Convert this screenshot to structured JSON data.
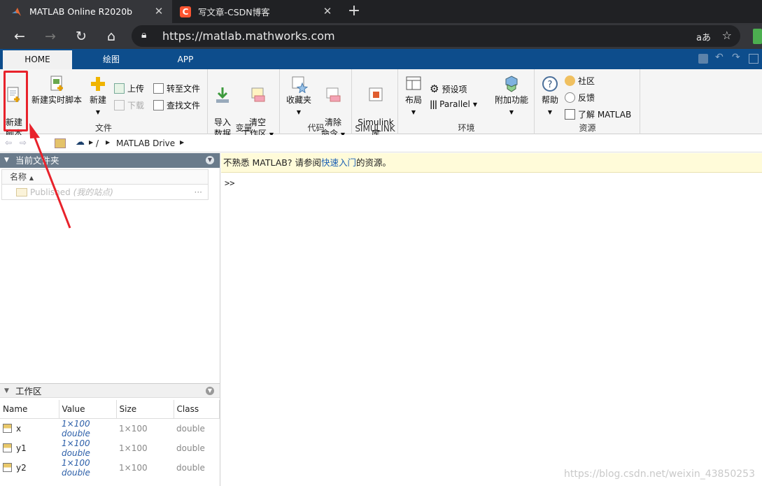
{
  "browser": {
    "tabs": [
      {
        "title": "MATLAB Online R2020b",
        "icon": "matlab-logo-icon"
      },
      {
        "title": "写文章-CSDN博客",
        "icon": "csdn-c-icon"
      }
    ],
    "url": "https://matlab.mathworks.com",
    "read_aloud": "aあ"
  },
  "ribbon_tabs": [
    "HOME",
    "绘图",
    "APP"
  ],
  "ribbon": {
    "file": {
      "label": "文件",
      "new_script": "新建\n脚本",
      "new_live_script": "新建实时脚本",
      "new": "新建",
      "upload": "上传",
      "download": "下载",
      "goto_file": "转至文件",
      "find_files": "查找文件"
    },
    "variable": {
      "label": "变量",
      "import_data": "导入\n数据",
      "clear_workspace": "清空\n工作区"
    },
    "code": {
      "label": "代码",
      "favorites": "收藏夹",
      "clear_commands": "清除\n命令"
    },
    "simulink": {
      "label": "SIMULINK",
      "library": "Simulink\n库"
    },
    "environment": {
      "label": "环境",
      "layout": "布局",
      "preferences": "预设项",
      "parallel": "Parallel",
      "addons": "附加功能"
    },
    "resources": {
      "label": "资源",
      "help": "帮助",
      "community": "社区",
      "feedback": "反馈",
      "learn_matlab": "了解 MATLAB"
    }
  },
  "path": {
    "sep": "/",
    "drive": "MATLAB Drive"
  },
  "current_folder": {
    "title": "当前文件夹",
    "col_name": "名称",
    "item_name": "Published",
    "item_note": "(我的站点)",
    "more": "···"
  },
  "workspace": {
    "title": "工作区",
    "columns": [
      "Name",
      "Value",
      "Size",
      "Class"
    ],
    "rows": [
      {
        "name": "x",
        "value": "1×100 double",
        "size": "1×100",
        "class": "double"
      },
      {
        "name": "y1",
        "value": "1×100 double",
        "size": "1×100",
        "class": "double"
      },
      {
        "name": "y2",
        "value": "1×100 double",
        "size": "1×100",
        "class": "double"
      }
    ]
  },
  "console": {
    "tip_pre": "不熟悉 MATLAB? 请参阅",
    "tip_link": "快速入门",
    "tip_post": "的资源。",
    "prompt": ">>"
  },
  "watermark": "https://blog.csdn.net/weixin_43850253",
  "colors": {
    "ribbon_blue": "#0d4d8c",
    "highlight_red": "#e8222b",
    "panel_header": "#6a7b8b"
  }
}
